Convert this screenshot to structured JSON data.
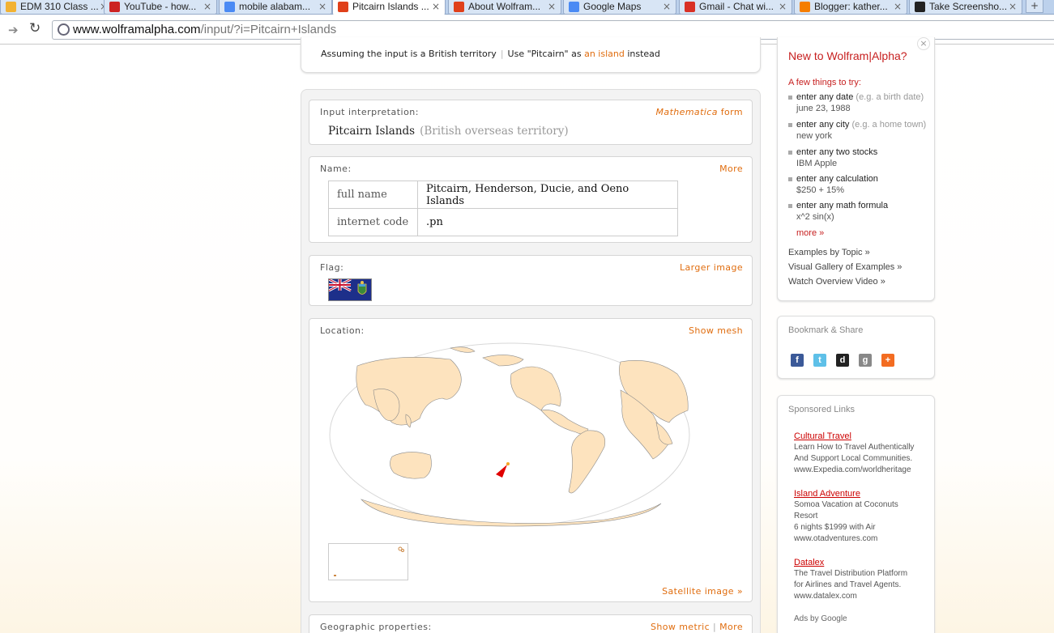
{
  "browser": {
    "tabs": [
      {
        "label": "EDM 310 Class ...",
        "icon_color": "#f2b233"
      },
      {
        "label": "YouTube - how...",
        "icon_color": "#cc2222"
      },
      {
        "label": "mobile alabam...",
        "icon_color": "#4a8af4"
      },
      {
        "label": "Pitcairn Islands ...",
        "icon_color": "#e0401a"
      },
      {
        "label": "About Wolfram...",
        "icon_color": "#e0401a"
      },
      {
        "label": "Google Maps",
        "icon_color": "#4a8af4"
      },
      {
        "label": "Gmail - Chat wi...",
        "icon_color": "#d93025"
      },
      {
        "label": "Blogger: kather...",
        "icon_color": "#f57d00"
      },
      {
        "label": "Take Screensho...",
        "icon_color": "#222222"
      }
    ],
    "new_tab": "+",
    "url_domain": "www.wolframalpha.com",
    "url_path": "/input/?i=Pitcairn+Islands"
  },
  "assumption": {
    "text": "Assuming the input is a British territory",
    "sep": "|",
    "use_prefix": "Use \"Pitcairn\" as",
    "alt_link": "an island",
    "suffix": "instead"
  },
  "pods": {
    "interpretation": {
      "title": "Input interpretation:",
      "action_italic": "Mathematica",
      "action": "form",
      "main": "Pitcairn Islands",
      "detail": "(British overseas territory)"
    },
    "name": {
      "title": "Name:",
      "action": "More",
      "rows": [
        {
          "key": "full name",
          "value": "Pitcairn, Henderson, Ducie, and Oeno Islands"
        },
        {
          "key": "internet code",
          "value": ".pn"
        }
      ]
    },
    "flag": {
      "title": "Flag:",
      "action": "Larger image"
    },
    "location": {
      "title": "Location:",
      "action": "Show mesh",
      "footer_link": "Satellite image »"
    },
    "geo": {
      "title": "Geographic properties:",
      "action1": "Show metric",
      "sep": "|",
      "action2": "More"
    }
  },
  "sidebar": {
    "close": "×",
    "title": "New to Wolfram|Alpha?",
    "subtitle": "A few things to try:",
    "items": [
      {
        "main": "enter any date",
        "example_hint": "(e.g. a birth date)",
        "example": "june 23, 1988"
      },
      {
        "main": "enter any city",
        "example_hint": "(e.g. a home town)",
        "example": "new york"
      },
      {
        "main": "enter any two stocks",
        "example_hint": "",
        "example": "IBM Apple"
      },
      {
        "main": "enter any calculation",
        "example_hint": "",
        "example": "$250 + 15%"
      },
      {
        "main": "enter any math formula",
        "example_hint": "",
        "example": "x^2 sin(x)"
      }
    ],
    "more": "more »",
    "links": [
      "Examples by Topic »",
      "Visual Gallery of Examples »",
      "Watch Overview Video »"
    ]
  },
  "bookmark": {
    "title": "Bookmark & Share",
    "icons": [
      {
        "name": "facebook",
        "glyph": "f",
        "color": "#3b5998"
      },
      {
        "name": "twitter",
        "glyph": "t",
        "color": "#5ec0e8"
      },
      {
        "name": "delicious",
        "glyph": "d",
        "color": "#222222"
      },
      {
        "name": "digg",
        "glyph": "g",
        "color": "#888888"
      },
      {
        "name": "more",
        "glyph": "+",
        "color": "#f36c21"
      }
    ]
  },
  "sponsored": {
    "title": "Sponsored Links",
    "ads": [
      {
        "headline": "Cultural Travel",
        "lines": [
          "Learn How to Travel Authentically",
          "And Support Local Communities.",
          "www.Expedia.com/worldheritage"
        ]
      },
      {
        "headline": "Island Adventure",
        "lines": [
          "Somoa Vacation at Coconuts",
          "Resort",
          "6 nights $1999 with Air",
          "www.otadventures.com"
        ]
      },
      {
        "headline": "Datalex",
        "lines": [
          "The Travel Distribution Platform",
          "for Airlines and Travel Agents.",
          "www.datalex.com"
        ]
      }
    ],
    "footer": "Ads by Google"
  }
}
